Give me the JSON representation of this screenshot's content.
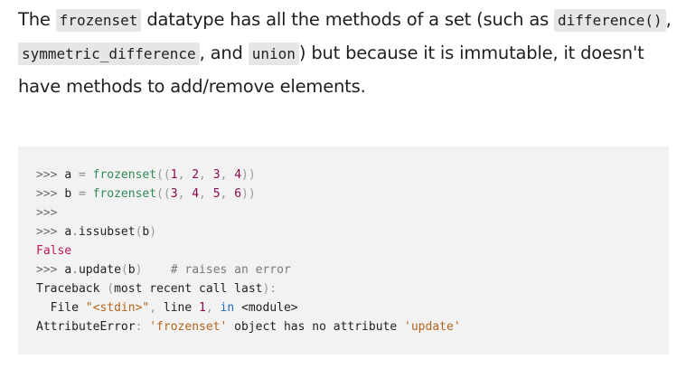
{
  "paragraph": {
    "t1": "The ",
    "c1": "frozenset",
    "t2": " datatype has all the methods of a set (such as ",
    "c2": "difference()",
    "t3": ", ",
    "c3": "symmetric_difference",
    "t4": ", and ",
    "c4": "union",
    "t5": ") but because it is immutable, it doesn't have methods to add/remove elements."
  },
  "code": {
    "prompt": ">>>",
    "l1": {
      "var": "a",
      "eq": "=",
      "fn": "frozenset",
      "open": "((",
      "n": [
        "1",
        "2",
        "3",
        "4"
      ],
      "close": "))"
    },
    "l2": {
      "var": "b",
      "eq": "=",
      "fn": "frozenset",
      "open": "((",
      "n": [
        "3",
        "4",
        "5",
        "6"
      ],
      "close": "))"
    },
    "l4": {
      "obj": "a",
      "dot": ".",
      "meth": "issubset",
      "open": "(",
      "arg": "b",
      "close": ")"
    },
    "l5": {
      "text": "False"
    },
    "l6": {
      "obj": "a",
      "dot": ".",
      "meth": "update",
      "open": "(",
      "arg": "b",
      "close": ")",
      "comment": "# raises an error"
    },
    "l7": {
      "a": "Traceback",
      "b": "(",
      "c": "most recent call last",
      "d": "):"
    },
    "l8": {
      "a": "  File ",
      "b": "\"<stdin>\"",
      "c": ", ",
      "d": "line",
      "e": " ",
      "f": "1",
      "g": ", ",
      "h": "in",
      "i": " ",
      "j": "<module>"
    },
    "l9": {
      "a": "AttributeError",
      "b": ":",
      "c": "'frozenset'",
      "d": "object",
      "e": "has",
      "f": "no",
      "g": "attribute",
      "h": "'update'"
    }
  },
  "colors": {
    "inline_code_bg": "#e6e6e6",
    "code_block_bg": "#f2f2f2",
    "builtin": "#2e8b57",
    "number": "#8b0a50",
    "keyword": "#1f6fbf",
    "string": "#b5651d"
  }
}
